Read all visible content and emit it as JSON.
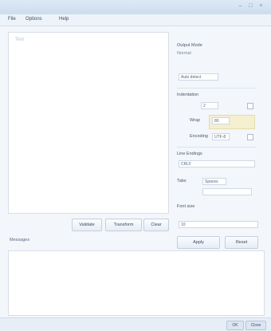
{
  "window": {
    "title": "",
    "controls": [
      "–",
      "□",
      "×"
    ]
  },
  "menu": [
    {
      "label": "File"
    },
    {
      "label": "Options"
    },
    {
      "label": "Help"
    }
  ],
  "editor": {
    "note": "Text"
  },
  "buttons": [
    {
      "label": "Validate"
    },
    {
      "label": "Transform"
    },
    {
      "label": "Clear"
    }
  ],
  "panel": {
    "group1_label": "Output Mode",
    "group1_value": "Normal",
    "group1_field": "Auto detect",
    "group2_label": "Indentation",
    "indent_field": "2",
    "row2_label": "Wrap",
    "row2_field": "80",
    "row3_label": "Encoding",
    "row3_field": "UTF-8",
    "section3_label": "Line Endings",
    "section3_field": "CRLF",
    "option_label": "Tabs",
    "option_field": "Spaces",
    "font_label": "Font size",
    "font_field": "10",
    "run_button": "Apply",
    "reset_button": "Reset"
  },
  "output": {
    "label": "Messages"
  },
  "status": {
    "ok_label": "OK",
    "cancel_label": "Close"
  }
}
